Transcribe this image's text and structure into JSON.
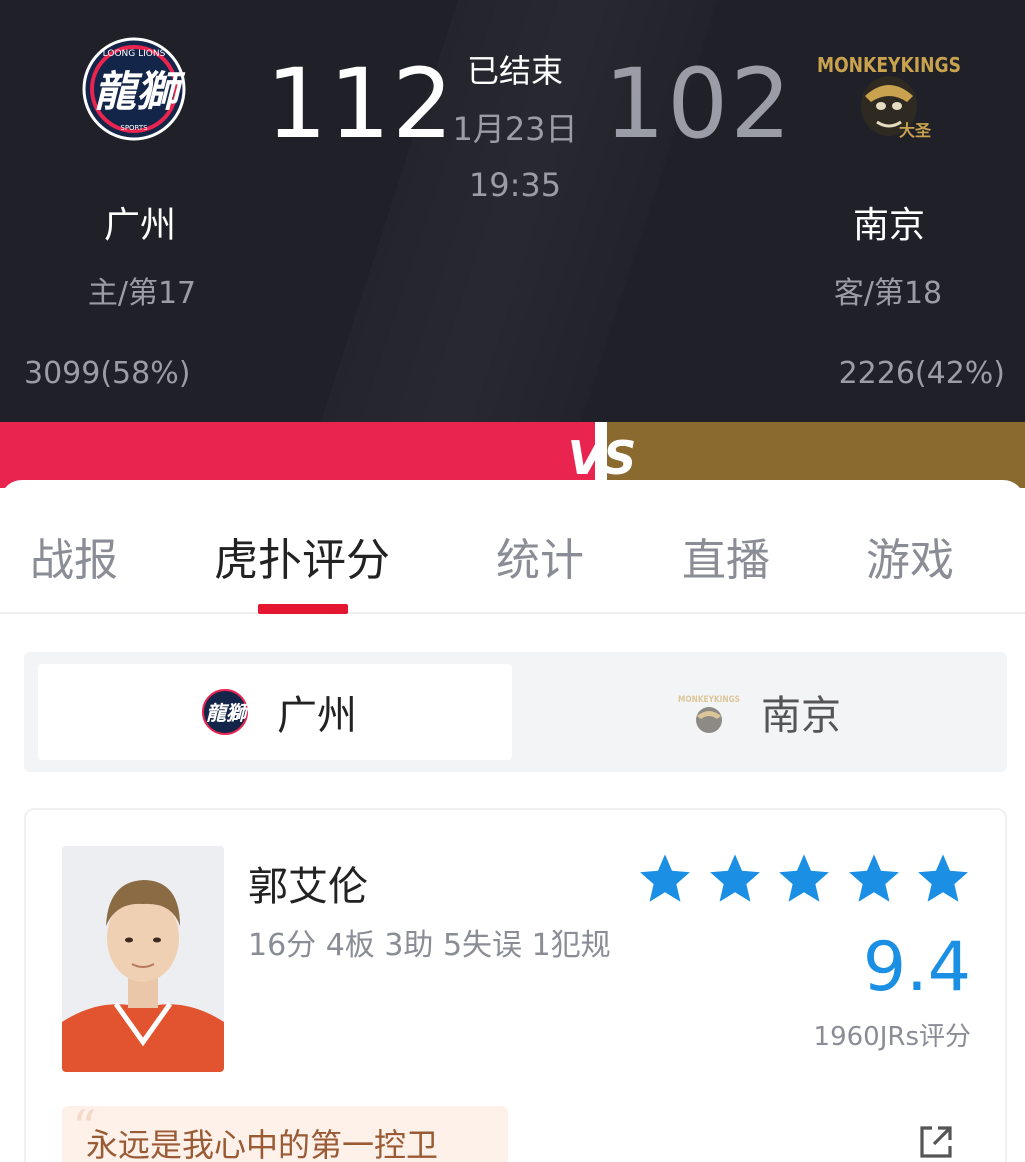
{
  "match": {
    "status": "已结束",
    "date": "1月23日",
    "time": "19:35"
  },
  "home": {
    "name": "广州",
    "score": "112",
    "rank": "主/第17",
    "support": "3099(58%)",
    "support_share": 0.58,
    "color": "#e8244f",
    "logo_text_top": "LOONG LIONS",
    "logo_text_main": "龍獅",
    "logo_text_bottom": "SPORTS"
  },
  "away": {
    "name": "南京",
    "score": "102",
    "rank": "客/第18",
    "support": "2226(42%)",
    "support_share": 0.42,
    "color": "#8a6a2e",
    "logo_text_main": "MONKEYKINGS",
    "logo_text_cn": "大圣"
  },
  "vs_label": "VS",
  "tabs": [
    {
      "label": "战报",
      "active": false
    },
    {
      "label": "虎扑评分",
      "active": true
    },
    {
      "label": "统计",
      "active": false
    },
    {
      "label": "直播",
      "active": false
    },
    {
      "label": "游戏",
      "active": false
    }
  ],
  "team_switch": {
    "home_label": "广州",
    "away_label": "南京",
    "active": "home"
  },
  "player_card": {
    "name": "郭艾伦",
    "stats": "16分 4板 3助 5失误 1犯规",
    "stars": 5,
    "rating": "9.4",
    "rating_count": "1960JRs评分",
    "comment": "永远是我心中的第一控卫",
    "star_color": "#1a8fe3"
  },
  "icons": {
    "share": "share-external-icon",
    "star": "star-icon"
  }
}
